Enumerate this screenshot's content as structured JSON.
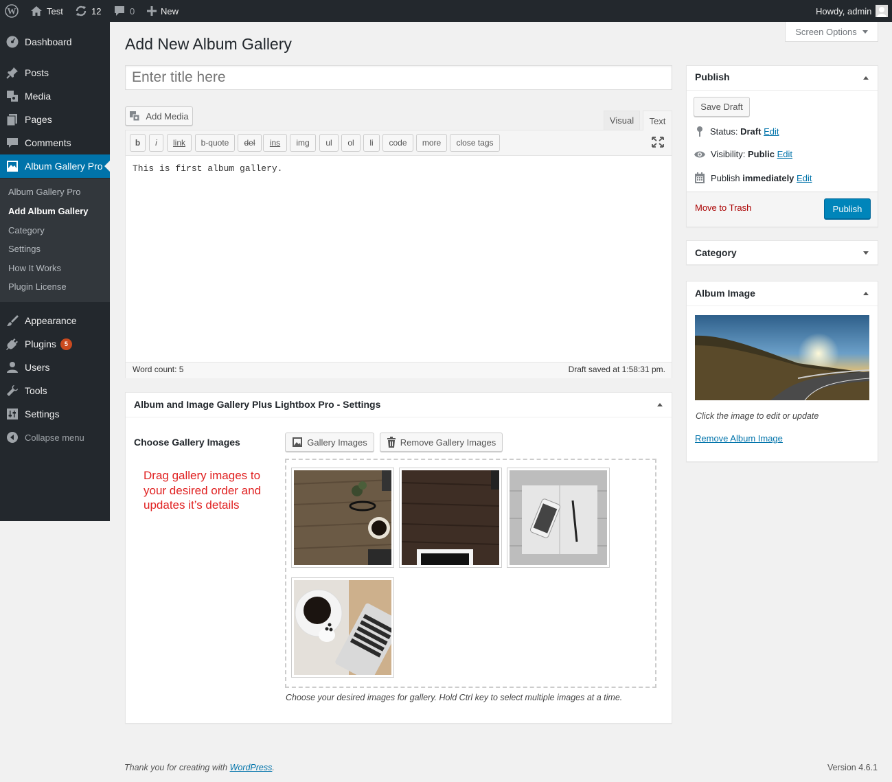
{
  "adminbar": {
    "site_name": "Test",
    "updates_count": "12",
    "comments_count": "0",
    "new_label": "New",
    "greeting": "Howdy, admin"
  },
  "sidebar": {
    "items": [
      {
        "label": "Dashboard",
        "icon": "dashboard-icon"
      },
      {
        "label": "Posts",
        "icon": "pushpin-icon"
      },
      {
        "label": "Media",
        "icon": "media-icon"
      },
      {
        "label": "Pages",
        "icon": "pages-icon"
      },
      {
        "label": "Comments",
        "icon": "comment-icon"
      },
      {
        "label": "Album Gallery Pro",
        "icon": "gallery-icon"
      },
      {
        "label": "Appearance",
        "icon": "brush-icon"
      },
      {
        "label": "Plugins",
        "icon": "plugin-icon",
        "badge": "5"
      },
      {
        "label": "Users",
        "icon": "user-icon"
      },
      {
        "label": "Tools",
        "icon": "wrench-icon"
      },
      {
        "label": "Settings",
        "icon": "settings-icon"
      }
    ],
    "submenu": [
      "Album Gallery Pro",
      "Add Album Gallery",
      "Category",
      "Settings",
      "How It Works",
      "Plugin License"
    ],
    "collapse_label": "Collapse menu",
    "accent": "#0073aa"
  },
  "screen_options": "Screen Options",
  "page_title": "Add New Album Gallery",
  "title_input": {
    "placeholder": "Enter title here",
    "value": ""
  },
  "editor": {
    "add_media": "Add Media",
    "tab_visual": "Visual",
    "tab_text": "Text",
    "quicktags": [
      "b",
      "i",
      "link",
      "b-quote",
      "del",
      "ins",
      "img",
      "ul",
      "ol",
      "li",
      "code",
      "more",
      "close tags"
    ],
    "content": "This is first album gallery.",
    "word_count": "Word count: 5",
    "draft_saved": "Draft saved at 1:58:31 pm."
  },
  "settings_box": {
    "title": "Album and Image Gallery Plus Lightbox Pro - Settings",
    "choose_label": "Choose Gallery Images",
    "gallery_images_btn": "Gallery Images",
    "remove_btn": "Remove Gallery Images",
    "annotation_lines": [
      "Drag gallery images to",
      "your desired order and",
      "updates it’s details"
    ],
    "annotation_color": "#e02020",
    "help_text": "Choose your desired images for gallery. Hold Ctrl key to select multiple images at a time."
  },
  "publish_box": {
    "title": "Publish",
    "save_draft": "Save Draft",
    "status_label": "Status:",
    "status_value": "Draft",
    "visibility_label": "Visibility:",
    "visibility_value": "Public",
    "publish_label": "Publish",
    "publish_value": "immediately",
    "edit": "Edit",
    "trash": "Move to Trash",
    "publish_btn": "Publish"
  },
  "category_box": {
    "title": "Category"
  },
  "album_image_box": {
    "title": "Album Image",
    "hint": "Click the image to edit or update",
    "remove_link": "Remove Album Image"
  },
  "footer": {
    "thanks_prefix": "Thank you for creating with",
    "wp_link": "WordPress",
    "thanks_suffix": ".",
    "version": "Version 4.6.1"
  }
}
